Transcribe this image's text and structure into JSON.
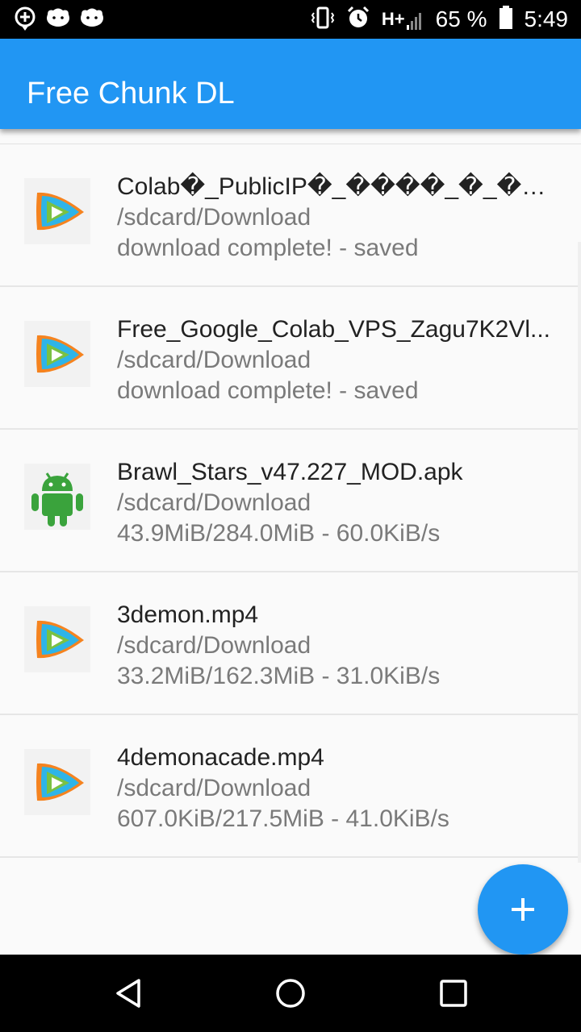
{
  "status_bar": {
    "battery_percent": "65 %",
    "time": "5:49",
    "network_label": "H+",
    "left_icons": [
      "add-location-icon",
      "cat-face-icon",
      "cat-face-icon"
    ],
    "right_icons": [
      "vibrate-icon",
      "alarm-icon",
      "h-plus-signal-icon",
      "signal-bars-icon",
      "battery-icon"
    ]
  },
  "app_bar": {
    "title": "Free Chunk DL",
    "color": "#2196f3"
  },
  "downloads": [
    {
      "icon": "video-player-icon",
      "title": "Colab�_PublicIP�_����_�_���_��_��_�...",
      "path": "/sdcard/Download",
      "status": "download complete! - saved"
    },
    {
      "icon": "video-player-icon",
      "title": "Free_Google_Colab_VPS_Zagu7K2Vl...",
      "path": "/sdcard/Download",
      "status": "download complete! - saved"
    },
    {
      "icon": "android-icon",
      "title": "Brawl_Stars_v47.227_MOD.apk",
      "path": "/sdcard/Download",
      "status": "43.9MiB/284.0MiB - 60.0KiB/s"
    },
    {
      "icon": "video-player-icon",
      "title": "3demon.mp4",
      "path": "/sdcard/Download",
      "status": "33.2MiB/162.3MiB - 31.0KiB/s"
    },
    {
      "icon": "video-player-icon",
      "title": "4demonacade.mp4",
      "path": "/sdcard/Download",
      "status": "607.0KiB/217.5MiB - 41.0KiB/s"
    }
  ],
  "fab": {
    "icon": "plus-icon",
    "color": "#2196f3"
  },
  "nav_bar": {
    "icons": [
      "back-icon",
      "home-icon",
      "recents-icon"
    ]
  }
}
